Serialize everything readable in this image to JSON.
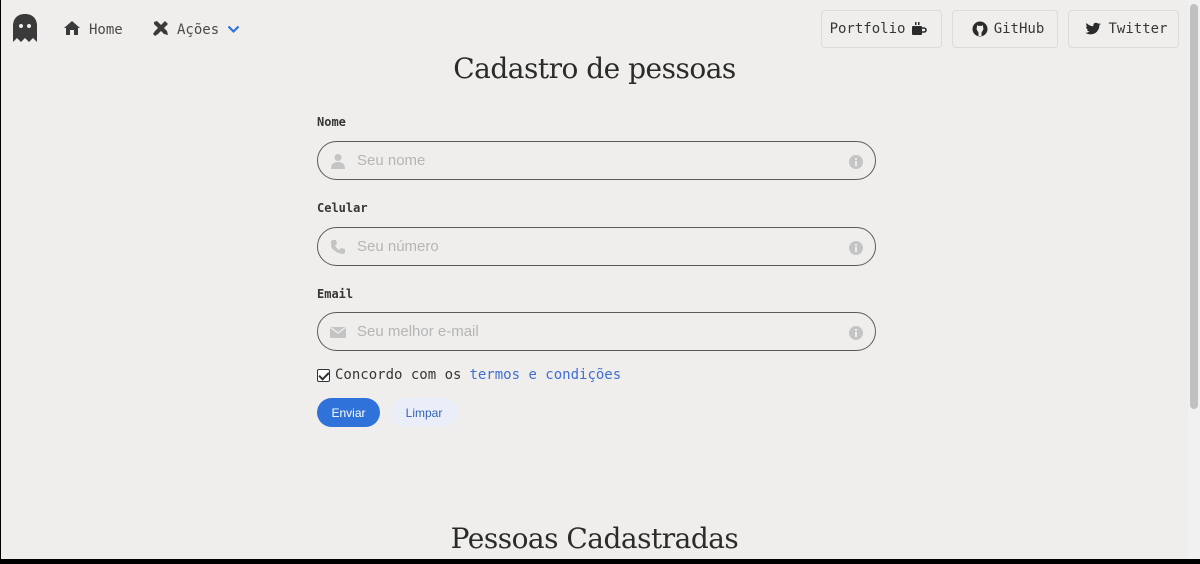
{
  "nav": {
    "home_label": "Home",
    "acoes_label": "Ações",
    "portfolio_label": "Portfolio",
    "github_label": "GitHub",
    "twitter_label": "Twitter",
    "accent_color": "#2f72d9"
  },
  "form": {
    "title": "Cadastro de pessoas",
    "nome": {
      "label": "Nome",
      "placeholder": "Seu nome",
      "value": ""
    },
    "celular": {
      "label": "Celular",
      "placeholder": "Seu número",
      "value": ""
    },
    "email": {
      "label": "Email",
      "placeholder": "Seu melhor e-mail",
      "value": ""
    },
    "terms": {
      "checked": true,
      "text": "Concordo com os",
      "link_text": "termos e condições"
    },
    "submit_label": "Enviar",
    "clear_label": "Limpar"
  },
  "list": {
    "title": "Pessoas Cadastradas"
  },
  "icons": {
    "logo": "ghost-icon",
    "home": "home-icon",
    "acoes": "tools-icon",
    "chevron": "chevron-down-icon",
    "portfolio": "coffee-icon",
    "github": "github-icon",
    "twitter": "twitter-icon",
    "nome": "user-icon",
    "celular": "phone-icon",
    "email": "envelope-icon",
    "info": "info-icon"
  }
}
